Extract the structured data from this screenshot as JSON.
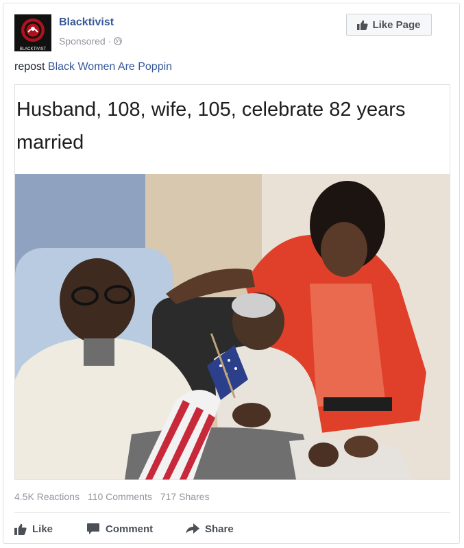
{
  "post": {
    "page_name": "Blacktivist",
    "sponsored_label": "Sponsored",
    "sponsored_separator": "·",
    "avatar_text": "BLACKTIVIST",
    "like_page_label": "Like Page",
    "text_prefix": "repost ",
    "text_link": "Black Women Are Poppin"
  },
  "shared": {
    "headline": "Husband, 108, wife, 105, celebrate 82 years married"
  },
  "stats": {
    "reactions": "4.5K Reactions",
    "comments": "110 Comments",
    "shares": "717 Shares"
  },
  "actions": {
    "like": "Like",
    "comment": "Comment",
    "share": "Share"
  },
  "colors": {
    "link": "#365899",
    "muted": "#90949c",
    "text": "#1d2129"
  },
  "icons": {
    "thumbs_up": "thumbs-up-icon",
    "globe": "globe-icon",
    "comment": "comment-icon",
    "share": "share-arrow-icon"
  }
}
